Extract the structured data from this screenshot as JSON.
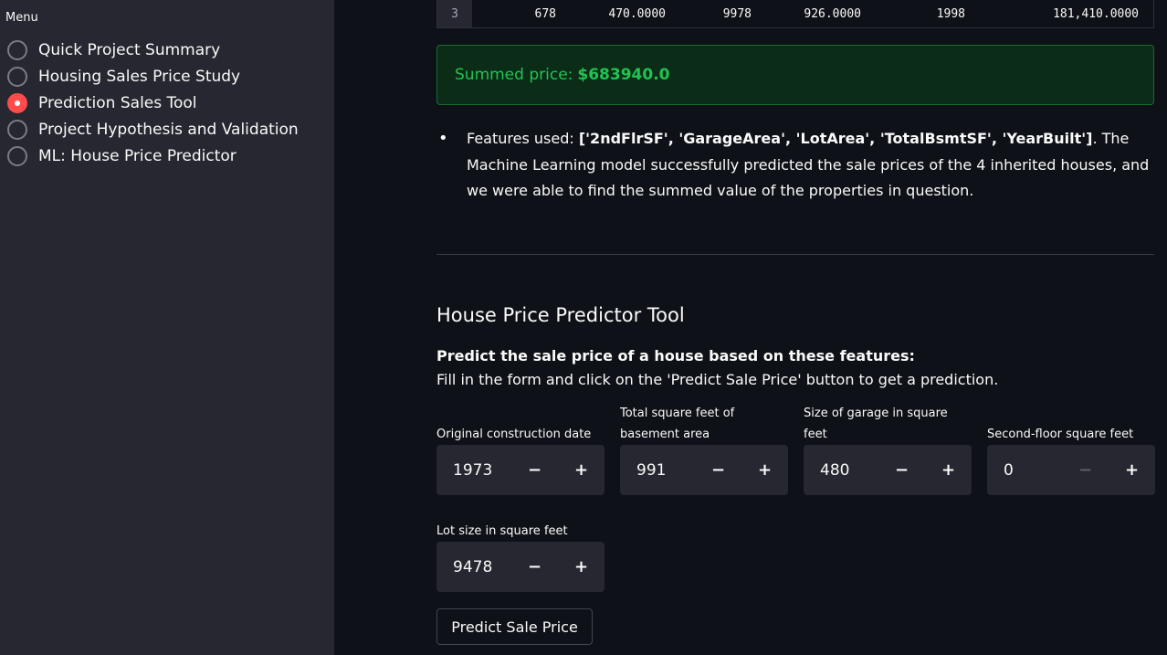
{
  "sidebar": {
    "title": "Menu",
    "items": [
      {
        "label": "Quick Project Summary",
        "selected": false
      },
      {
        "label": "Housing Sales Price Study",
        "selected": false
      },
      {
        "label": "Prediction Sales Tool",
        "selected": true
      },
      {
        "label": "Project Hypothesis and Validation",
        "selected": false
      },
      {
        "label": "ML: House Price Predictor",
        "selected": false
      }
    ]
  },
  "table": {
    "row": {
      "index": "3",
      "cells": [
        "678",
        "470.0000",
        "9978",
        "926.0000",
        "1998",
        "181,410.0000"
      ]
    }
  },
  "summary": {
    "label": "Summed price:",
    "amount": "$683940.0"
  },
  "features_note": {
    "prefix": "Features used:",
    "features": "['2ndFlrSF', 'GarageArea', 'LotArea', 'TotalBsmtSF', 'YearBuilt']",
    "suffix": ". The Machine Learning model successfully predicted the sale prices of the 4 inherited houses, and we were able to find the summed value of the properties in question."
  },
  "tool": {
    "title": "House Price Predictor Tool",
    "subhead": "Predict the sale price of a house based on these features:",
    "instructions": "Fill in the form and click on the 'Predict Sale Price' button to get a prediction.",
    "fields": [
      {
        "label": "Original construction date",
        "value": "1973"
      },
      {
        "label": "Total square feet of basement area",
        "value": "991"
      },
      {
        "label": "Size of garage in square feet",
        "value": "480"
      },
      {
        "label": "Second-floor square feet",
        "value": "0"
      },
      {
        "label": "Lot size in square feet",
        "value": "9478"
      }
    ],
    "minus": "−",
    "plus": "+",
    "button_label": "Predict Sale Price"
  },
  "colors": {
    "accent": "#ff4b4b",
    "success_text": "#21c354",
    "success_bg": "#0b2c17"
  }
}
